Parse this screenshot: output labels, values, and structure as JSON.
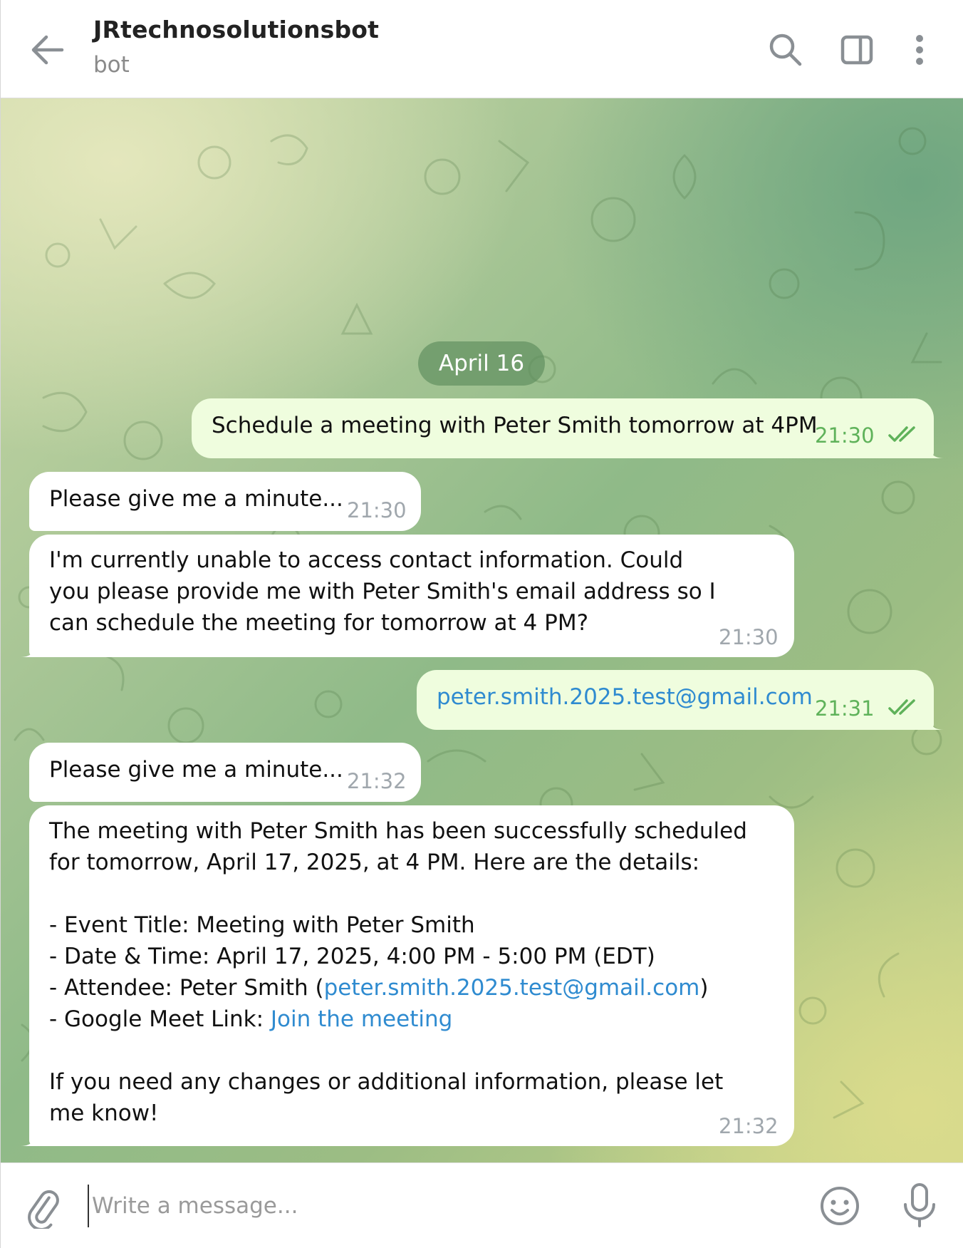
{
  "header": {
    "title": "JRtechnosolutionsbot",
    "subtitle": "bot",
    "icons": [
      "back-arrow-icon",
      "search-icon",
      "side-panel-icon",
      "more-vertical-icon"
    ]
  },
  "chat": {
    "date_separator": "April 16",
    "messages": [
      {
        "direction": "out",
        "text": "Schedule a meeting with Peter Smith tomorrow at 4PM",
        "time": "21:30",
        "status": "read"
      },
      {
        "direction": "in",
        "text": "Please give me a minute...",
        "time": "21:30"
      },
      {
        "direction": "in",
        "text": "I'm currently unable to access contact information. Could you please provide me with Peter Smith's email address so I can schedule the meeting for tomorrow at 4 PM?",
        "time": "21:30"
      },
      {
        "direction": "out",
        "text": "peter.smith.2025.test@gmail.com",
        "time": "21:31",
        "status": "read"
      },
      {
        "direction": "in",
        "text": "Please give me a minute...",
        "time": "21:32"
      },
      {
        "direction": "in",
        "time": "21:32",
        "intro": "The meeting with Peter Smith has been successfully scheduled for tomorrow, April 17, 2025, at 4 PM. Here are the details:",
        "details": {
          "event_title": "- Event Title: Meeting with Peter Smith",
          "date_time": "- Date & Time: April 17, 2025, 4:00 PM - 5:00 PM (EDT)",
          "attendee_prefix": "- Attendee: Peter Smith (",
          "attendee_email": "peter.smith.2025.test@gmail.com",
          "attendee_suffix": ")",
          "meet_prefix": "- Google Meet Link: ",
          "meet_link_text": "Join the meeting"
        },
        "outro": "If you need any changes or additional information, please let me know!"
      }
    ]
  },
  "composer": {
    "placeholder": "Write a message...",
    "icons": [
      "paperclip-icon",
      "emoji-icon",
      "microphone-icon"
    ]
  },
  "colors": {
    "outgoing_bubble": "#effdde",
    "incoming_bubble": "#ffffff",
    "link": "#2f8bd0",
    "read_check": "#5fb25a",
    "timestamp": "#a0a7ad"
  }
}
